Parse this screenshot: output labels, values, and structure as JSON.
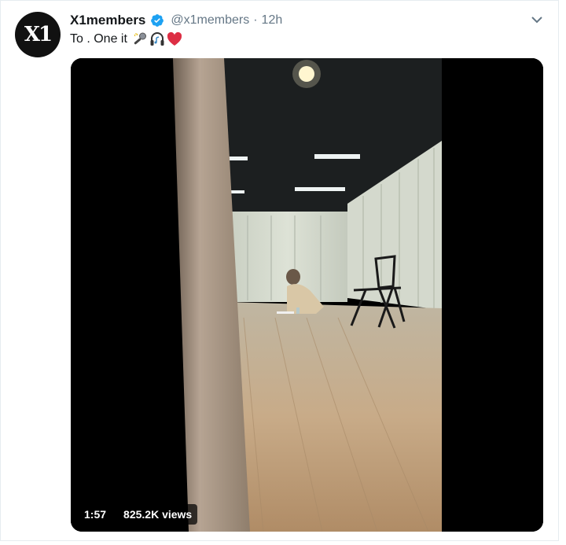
{
  "account": {
    "display_name": "X1members",
    "handle": "@x1members",
    "separator": "·",
    "time": "12h",
    "avatar_logo_text": "X1"
  },
  "tweet": {
    "text": "To . One it"
  },
  "media": {
    "duration": "1:57",
    "views": "825.2K views"
  },
  "icons": {
    "verified": "verified-badge-icon",
    "caret": "chevron-down-icon",
    "emojis": [
      "microphone-emoji",
      "headphone-emoji",
      "heart-emoji"
    ]
  },
  "colors": {
    "verified_blue": "#1da1f2",
    "heart_red": "#e0245e"
  }
}
